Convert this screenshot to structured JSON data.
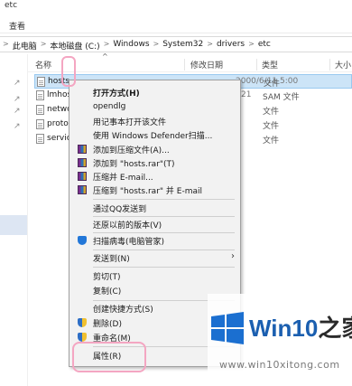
{
  "window": {
    "title_partial": "etc"
  },
  "ribbon": {
    "tab_view": "查看"
  },
  "address": {
    "crumbs": [
      "此电脑",
      "本地磁盘 (C:)",
      "Windows",
      "System32",
      "drivers",
      "etc"
    ],
    "separator": ">"
  },
  "columns": {
    "name": "名称",
    "date": "修改日期",
    "type": "类型",
    "size": "大小"
  },
  "files": [
    {
      "name": "hosts",
      "date": "2000/6/11 5:00",
      "type": "文件",
      "selected": true
    },
    {
      "name": "lmhost",
      "date": "21",
      "type": "SAM 文件"
    },
    {
      "name": "networ",
      "date": "",
      "type": "文件"
    },
    {
      "name": "protoc",
      "date": "",
      "type": "文件"
    },
    {
      "name": "service",
      "date": "",
      "type": "文件"
    }
  ],
  "context_menu": {
    "open_with_default": "打开方式(H)",
    "opendlg": "opendlg",
    "open_notepad": "用记事本打开该文件",
    "defender_scan": "使用 Windows Defender扫描...",
    "add_archive": "添加到压缩文件(A)...",
    "add_hosts_rar": "添加到 \"hosts.rar\"(T)",
    "compress_email": "压缩并 E-mail...",
    "compress_hosts_email": "压缩到 \"hosts.rar\" 并 E-mail",
    "send_qq": "通过QQ发送到",
    "restore_versions": "还原以前的版本(V)",
    "scan_virus": "扫描病毒(电脑管家)",
    "send_to": "发送到(N)",
    "cut": "剪切(T)",
    "copy": "复制(C)",
    "create_shortcut": "创建快捷方式(S)",
    "delete": "删除(D)",
    "rename": "重命名(M)",
    "properties": "属性(R)"
  },
  "watermark": {
    "brand_win": "Win10",
    "brand_zh": "之家",
    "url": "www.win10xitong.com"
  },
  "colors": {
    "accent": "#1b5fb0",
    "selection": "#cce4f7",
    "annotation": "#f4a6c2"
  }
}
